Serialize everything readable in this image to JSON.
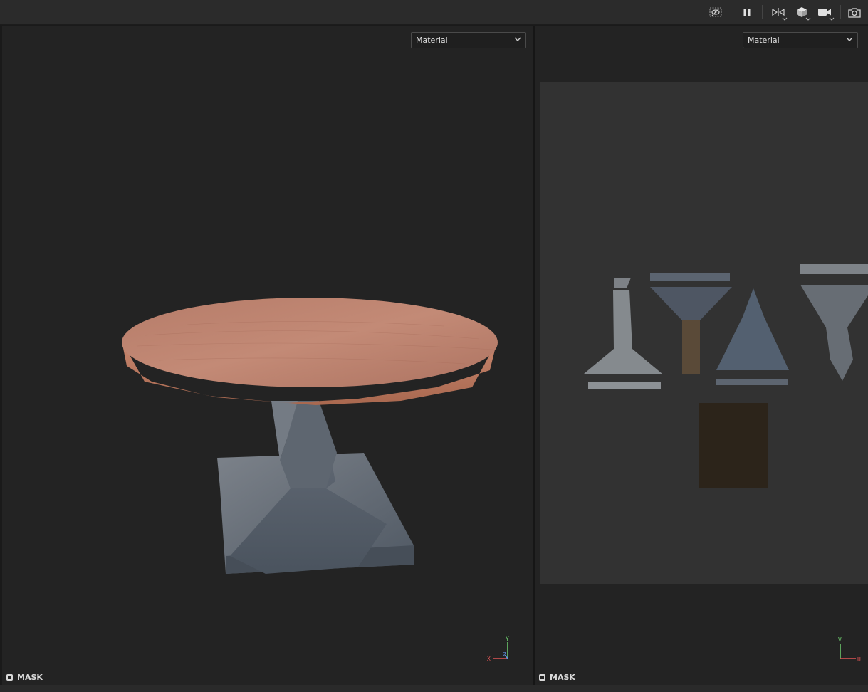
{
  "toolbar": {
    "icons": [
      "hide-icon",
      "pause-icon",
      "split-view-icon",
      "cube-icon",
      "camera-icon",
      "screenshot-icon"
    ]
  },
  "viewport_3d": {
    "dropdown_value": "Material",
    "mask_label": "MASK",
    "axis": {
      "x": "X",
      "y": "Y",
      "z": "Z"
    }
  },
  "viewport_2d": {
    "dropdown_value": "Material",
    "mask_label": "MASK",
    "axis": {
      "u": "U",
      "v": "V"
    }
  },
  "colors": {
    "background": "#232323",
    "toolbar": "#2b2b2b",
    "wood": "#b97a66",
    "stone": "#5a6370"
  }
}
